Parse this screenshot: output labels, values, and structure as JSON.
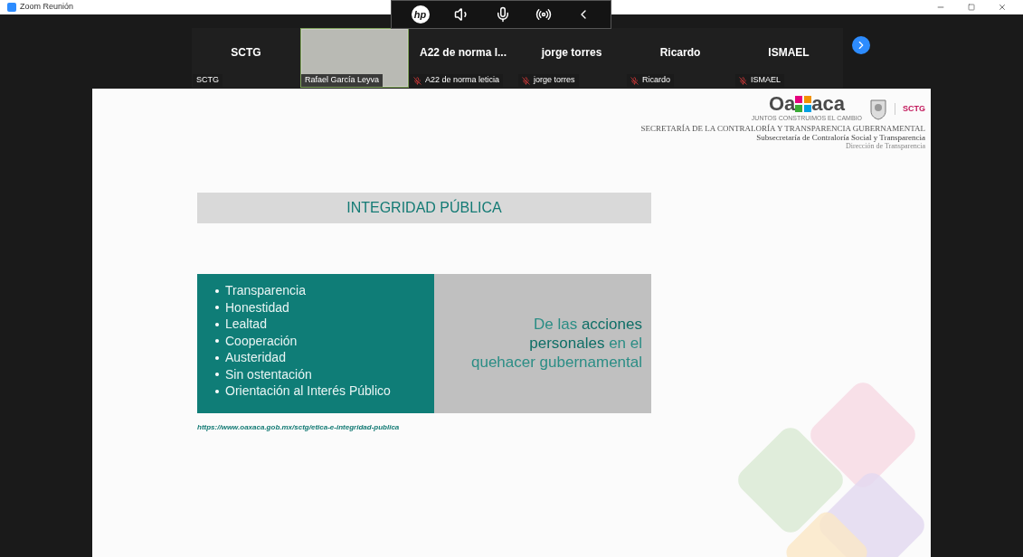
{
  "window": {
    "title": "Zoom Reunión"
  },
  "meeting_toolbar": {
    "logo": "hp"
  },
  "participants": [
    {
      "kind": "name",
      "tile_name": "SCTG",
      "label": "SCTG",
      "muted": false,
      "active": false
    },
    {
      "kind": "video",
      "label": "Rafael García Leyva",
      "muted": false,
      "active": true
    },
    {
      "kind": "name",
      "tile_name": "A22 de norma l...",
      "label": "A22 de norma leticia",
      "muted": true,
      "active": false
    },
    {
      "kind": "name",
      "tile_name": "jorge torres",
      "label": "jorge torres",
      "muted": true,
      "active": false
    },
    {
      "kind": "name",
      "tile_name": "Ricardo",
      "label": "Ricardo",
      "muted": true,
      "active": false
    },
    {
      "kind": "name",
      "tile_name": "ISMAEL",
      "label": "ISMAEL",
      "muted": true,
      "active": false
    }
  ],
  "slide": {
    "logo": {
      "left": "Oa",
      "right": "aca",
      "tagline": "JUNTOS CONSTRUIMOS EL CAMBIO",
      "badge": "SCTG"
    },
    "header_lines": [
      "SECRETARÍA DE LA CONTRALORÍA Y TRANSPARENCIA GUBERNAMENTAL",
      "Subsecretaría de Contraloría Social y Transparencia",
      "Dirección de Transparencia"
    ],
    "title": "INTEGRIDAD PÚBLICA",
    "values": [
      "Transparencia",
      "Honestidad",
      "Lealtad",
      "Cooperación",
      "Austeridad",
      "Sin ostentación",
      "Orientación al Interés Público"
    ],
    "statement": "De las **acciones personales** en el quehacer gubernamental",
    "link": "https://www.oaxaca.gob.mx/sctg/etica-e-integridad-publica"
  }
}
